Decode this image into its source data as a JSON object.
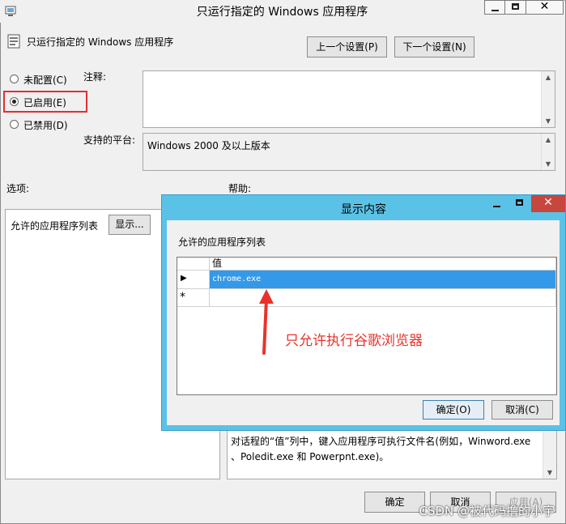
{
  "window": {
    "title": "只运行指定的 Windows 应用程序",
    "policy_name": "只运行指定的 Windows 应用程序",
    "prev_button": "上一个设置(P)",
    "next_button": "下一个设置(N)"
  },
  "state": {
    "not_configured": "未配置(C)",
    "enabled": "已启用(E)",
    "disabled": "已禁用(D)",
    "selected": "enabled"
  },
  "labels": {
    "comment": "注释:",
    "platform": "支持的平台:",
    "platform_value": "Windows 2000 及以上版本",
    "options": "选项:",
    "help": "帮助:"
  },
  "options_panel": {
    "allowed_list_label": "允许的应用程序列表",
    "show_button": "显示..."
  },
  "help_text": {
    "line1": "对话程的“值”列中，键入应用程序可执行文件名(例如，Winword.exe",
    "line2": "、Poledit.exe 和 Powerpnt.exe)。"
  },
  "footer": {
    "ok": "确定",
    "cancel": "取消",
    "apply": "应用(A)"
  },
  "dialog": {
    "title": "显示内容",
    "list_label": "允许的应用程序列表",
    "column_header": "值",
    "rows": [
      {
        "marker": "▶",
        "value": "chrome.exe"
      },
      {
        "marker": "*",
        "value": ""
      }
    ],
    "ok_button": "确定(O)",
    "cancel_button": "取消(C)"
  },
  "annotation": {
    "text": "只允许执行谷歌浏览器",
    "color": "#e8332c"
  },
  "watermark": "CSDN @被代码撸的小宇",
  "colors": {
    "dialog_border": "#5bc2e7",
    "selection": "#3399e8",
    "close_button": "#c7463e"
  }
}
